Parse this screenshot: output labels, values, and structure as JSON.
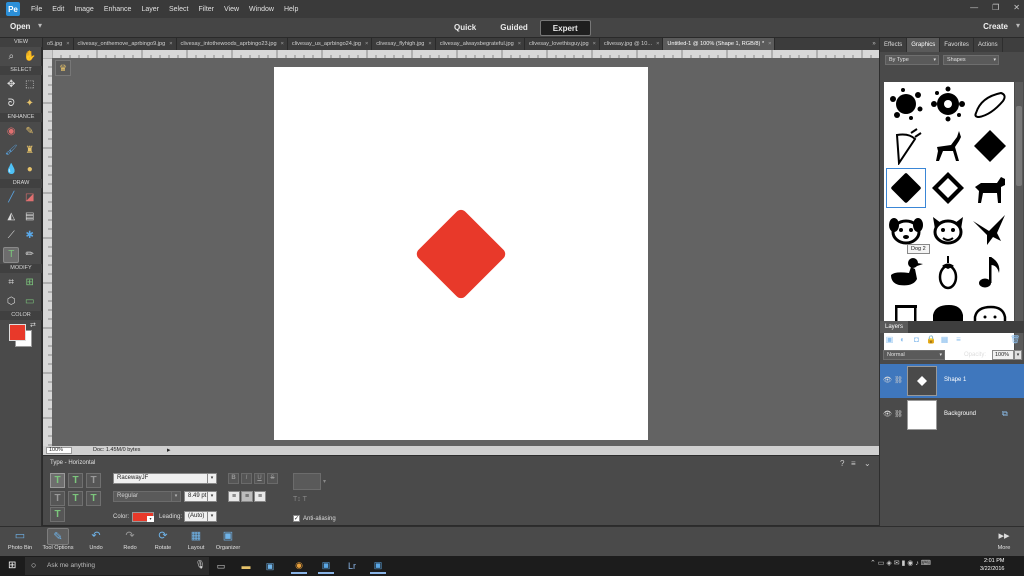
{
  "menubar": {
    "items": [
      "File",
      "Edit",
      "Image",
      "Enhance",
      "Layer",
      "Select",
      "Filter",
      "View",
      "Window",
      "Help"
    ]
  },
  "modebar": {
    "open_label": "Open",
    "modes": [
      "Quick",
      "Guided",
      "Expert"
    ],
    "active_mode": "Expert",
    "create_label": "Create"
  },
  "toolbox": {
    "sections": [
      "VIEW",
      "SELECT",
      "ENHANCE",
      "DRAW",
      "MODIFY",
      "COLOR"
    ]
  },
  "doc_tabs": [
    "o5.jpg",
    "clivesay_onthemove_aprbingo9.jpg",
    "clivesay_intothewoods_aprbingo23.jpg",
    "clivesay_us_aprbingo24.jpg",
    "clivesay_flyhigh.jpg",
    "clivesay_alwaysbegrateful.jpg",
    "clivesay_lovethisguy.jpg",
    "clivesay.jpg @ 10...",
    "Untitled-1 @ 100% (Shape 1, RGB/8) *"
  ],
  "active_doc_tab": 8,
  "canvas": {
    "shape_color": "#e8392a"
  },
  "statusbar": {
    "zoom": "100%",
    "doc_info": "Doc: 1.45M/0 bytes"
  },
  "tool_options": {
    "title": "Type - Horizontal",
    "font_family": "RacewayJF",
    "font_style": "Regular",
    "font_size": "8.49 pt",
    "color_label": "Color:",
    "leading_label": "Leading:",
    "leading_value": "(Auto)",
    "antialias_label": "Anti-aliasing",
    "format_buttons": [
      "B",
      "I",
      "U",
      "S"
    ]
  },
  "right_panel": {
    "tabs": [
      "Effects",
      "Graphics",
      "Favorites",
      "Actions"
    ],
    "active_tab": "Graphics",
    "filter_by": "By Type",
    "filter_category": "Shapes",
    "tooltip": "Dog 2"
  },
  "layers": {
    "tab_label": "Layers",
    "blend_mode": "Normal",
    "opacity_label": "Opacity:",
    "opacity_value": "100%",
    "items": [
      {
        "name": "Shape 1",
        "selected": true
      },
      {
        "name": "Background",
        "selected": false
      }
    ]
  },
  "bottombar": {
    "items": [
      "Photo Bin",
      "Tool Options",
      "Undo",
      "Redo",
      "Rotate",
      "Layout",
      "Organizer"
    ],
    "more_label": "More"
  },
  "taskbar": {
    "search_placeholder": "Ask me anything",
    "time": "2:01 PM",
    "date": "3/22/2016"
  }
}
